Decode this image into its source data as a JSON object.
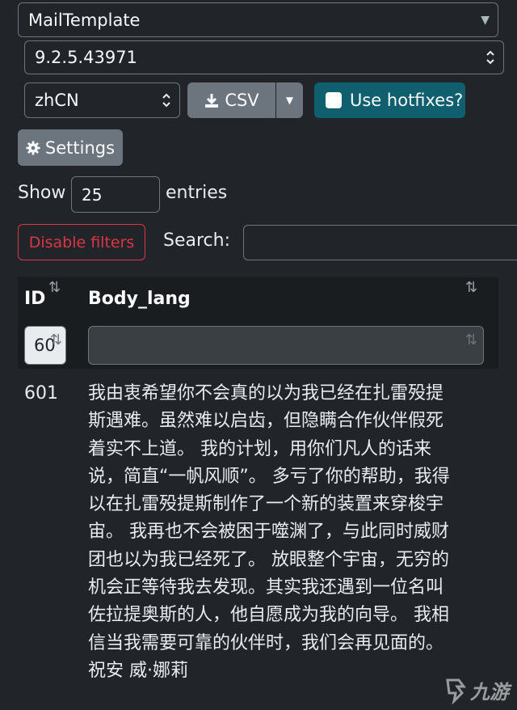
{
  "filters": {
    "table_select": {
      "value": "MailTemplate"
    },
    "build_select": {
      "value": "9.2.5.43971"
    },
    "locale_select": {
      "value": "zhCN"
    },
    "csv_button": {
      "label": "CSV"
    },
    "hotfix_toggle": {
      "label": "Use hotfixes?",
      "checked": false
    },
    "settings_button": {
      "label": "Settings"
    }
  },
  "table_controls": {
    "show_label": "Show",
    "entries_value": "25",
    "entries_label": "entries",
    "disable_filters_label": "Disable filters",
    "search_label": "Search:",
    "search_value": ""
  },
  "table": {
    "columns": [
      {
        "label": "ID"
      },
      {
        "label": "Body_lang"
      }
    ],
    "column_filters": {
      "id": "60",
      "body": ""
    },
    "rows": [
      {
        "id": "601",
        "body_lines": [
          "我由衷希望你不会真的以为我已经在扎雷殁提",
          "斯遇难。虽然难以启齿，但隐瞒合作伙伴假死",
          "着实不上道。 我的计划，用你们凡人的话来",
          "说，简直“一帆风顺”。 多亏了你的帮助，我得",
          "以在扎雷殁提斯制作了一个新的装置来穿梭宇",
          "宙。 我再也不会被困于噬渊了，与此同时威财",
          "团也以为我已经死了。 放眼整个宇宙，无穷的",
          "机会正等待我去发现。其实我还遇到一位名叫",
          "佐拉提奥斯的人，他自愿成为我的向导。 我相",
          "信当我需要可靠的伙伴时，我们会再见面的。",
          "祝安 威·娜莉"
        ]
      }
    ]
  },
  "watermark": {
    "text": "九游"
  },
  "colors": {
    "background": "#212529",
    "hotfix_button": "#0f5f6e",
    "grey_button": "#6c757d",
    "danger": "#dc3545"
  }
}
